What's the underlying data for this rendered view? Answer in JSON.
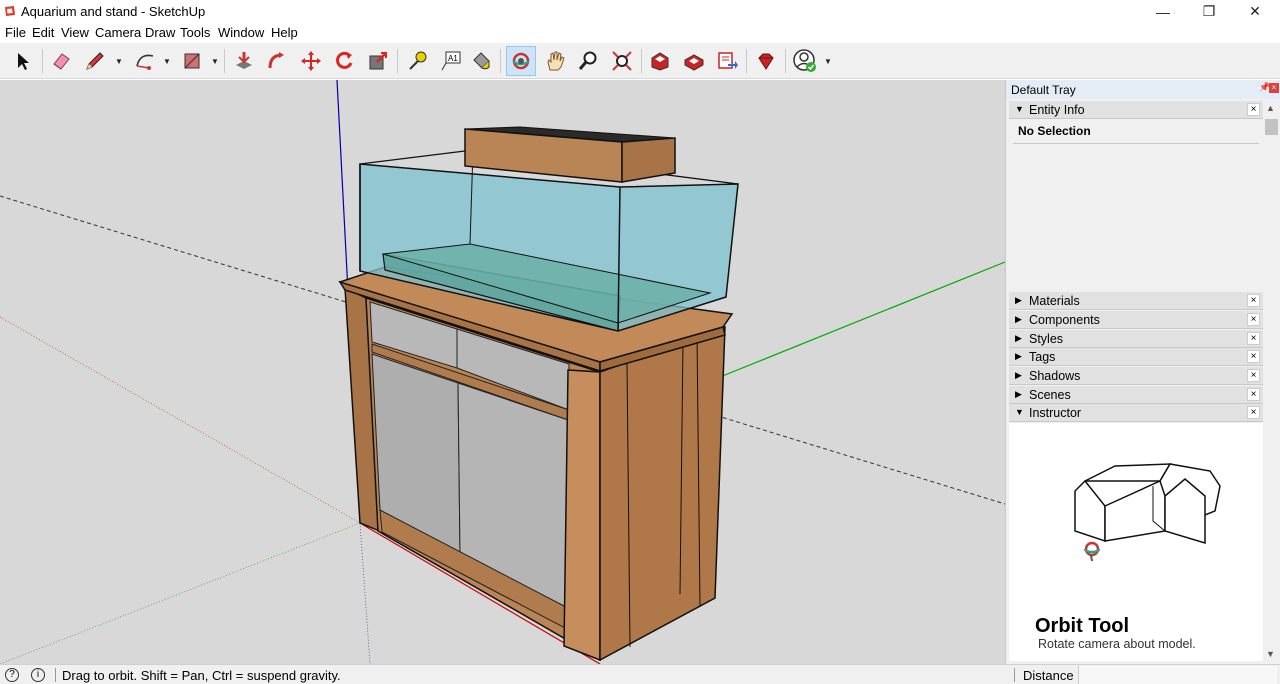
{
  "window": {
    "title": "Aquarium and stand - SketchUp",
    "minimize": "—",
    "restore": "❐",
    "close": "✕"
  },
  "menu": [
    "File",
    "Edit",
    "View",
    "Camera",
    "Draw",
    "Tools",
    "Window",
    "Help"
  ],
  "toolbar": {
    "tools": [
      {
        "name": "select-tool",
        "icon": "arrow-icon"
      },
      {
        "name": "eraser-tool",
        "icon": "eraser-icon"
      },
      {
        "name": "line-tool",
        "icon": "pencil-icon"
      },
      {
        "name": "arc-tool",
        "icon": "arc-icon"
      },
      {
        "name": "rectangle-tool",
        "icon": "rectangle-icon"
      },
      {
        "name": "push-pull-tool",
        "icon": "push-pull-icon"
      },
      {
        "name": "follow-me-tool",
        "icon": "follow-me-icon"
      },
      {
        "name": "move-tool",
        "icon": "move-icon"
      },
      {
        "name": "rotate-tool",
        "icon": "rotate-icon"
      },
      {
        "name": "scale-tool",
        "icon": "scale-icon"
      },
      {
        "name": "tape-measure-tool",
        "icon": "tape-measure-icon"
      },
      {
        "name": "text-tool",
        "icon": "text-icon"
      },
      {
        "name": "paint-bucket-tool",
        "icon": "paint-bucket-icon"
      },
      {
        "name": "orbit-tool",
        "icon": "orbit-icon"
      },
      {
        "name": "pan-tool",
        "icon": "hand-icon"
      },
      {
        "name": "zoom-tool",
        "icon": "magnifier-icon"
      },
      {
        "name": "zoom-extents-tool",
        "icon": "zoom-extents-icon"
      },
      {
        "name": "warehouse-tool",
        "icon": "warehouse-icon"
      },
      {
        "name": "extension-warehouse-tool",
        "icon": "extension-icon"
      },
      {
        "name": "send-to-layout-tool",
        "icon": "layout-icon"
      },
      {
        "name": "ruby-console-tool",
        "icon": "ruby-icon"
      },
      {
        "name": "account-tool",
        "icon": "account-icon"
      }
    ],
    "text_tool_label": "A1",
    "active_tool": "orbit-tool"
  },
  "tray": {
    "title": "Default Tray",
    "entity_info": {
      "label": "Entity Info",
      "selection": "No Selection"
    },
    "panels": [
      "Materials",
      "Components",
      "Styles",
      "Tags",
      "Shadows",
      "Scenes"
    ],
    "instructor": {
      "label": "Instructor",
      "tool_title": "Orbit Tool",
      "tool_desc": "Rotate camera about model."
    }
  },
  "status": {
    "message": "Drag to orbit. Shift = Pan, Ctrl = suspend gravity.",
    "measurement_label": "Distance",
    "measurement_value": ""
  },
  "colors": {
    "viewport_bg": "#d8d8d8",
    "wood": "#b98555",
    "glass": "#7cc1cf",
    "panel_grey": "#b9b9b9",
    "axis_red": "#cc0000",
    "axis_green": "#00aa00",
    "axis_blue": "#0000aa",
    "accent_active": "#cde4f7"
  }
}
